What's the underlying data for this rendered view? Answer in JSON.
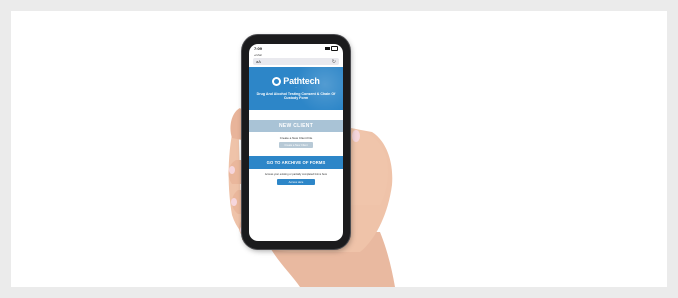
{
  "status_bar": {
    "time": "7:09",
    "carrier": "◂ Mail"
  },
  "browser": {
    "url_text": "aA",
    "reload_icon": "reload-icon"
  },
  "hero": {
    "logo_text": "Pathtech",
    "logo_sub": "...",
    "title": "Drug And Alcohol Testing Consent & Chain Of Custody Form"
  },
  "new_client": {
    "heading": "NEW CLIENT",
    "prompt": "Create a New Client File",
    "button": "Create a New Client"
  },
  "archive": {
    "heading": "GO TO ARCHIVE OF FORMS",
    "prompt": "Access your existing or partially completed forms here",
    "button": "Access Here"
  },
  "colors": {
    "brand_blue": "#2d86c8",
    "disabled_blue": "#a9c3d6",
    "page_bg": "#ebebeb"
  }
}
